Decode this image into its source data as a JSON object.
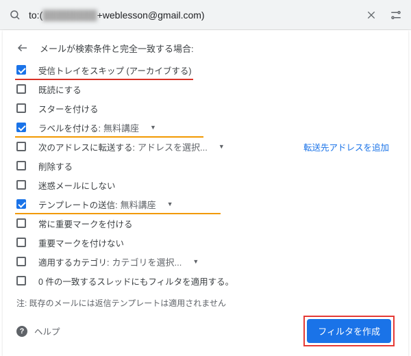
{
  "search": {
    "query_prefix": "to:(",
    "query_blur": "████████",
    "query_suffix": "+weblesson@gmail.com)"
  },
  "header": {
    "title": "メールが検索条件と完全一致する場合:"
  },
  "opts": {
    "skip_inbox": "受信トレイをスキップ (アーカイブする)",
    "mark_read": "既読にする",
    "star": "スターを付ける",
    "apply_label": "ラベルを付ける:",
    "label_value": "無料講座",
    "forward": "次のアドレスに転送する:",
    "forward_value": "アドレスを選択...",
    "forward_link": "転送先アドレスを追加",
    "delete": "削除する",
    "never_spam": "迷惑メールにしない",
    "send_template": "テンプレートの送信:",
    "template_value": "無料講座",
    "always_important": "常に重要マークを付ける",
    "never_important": "重要マークを付けない",
    "categorize": "適用するカテゴリ:",
    "categorize_value": "カテゴリを選択...",
    "apply_matching": "0 件の一致するスレッドにもフィルタを適用する。"
  },
  "note": "注: 既存のメールには返信テンプレートは適用されません",
  "footer": {
    "help": "ヘルプ",
    "create": "フィルタを作成"
  }
}
